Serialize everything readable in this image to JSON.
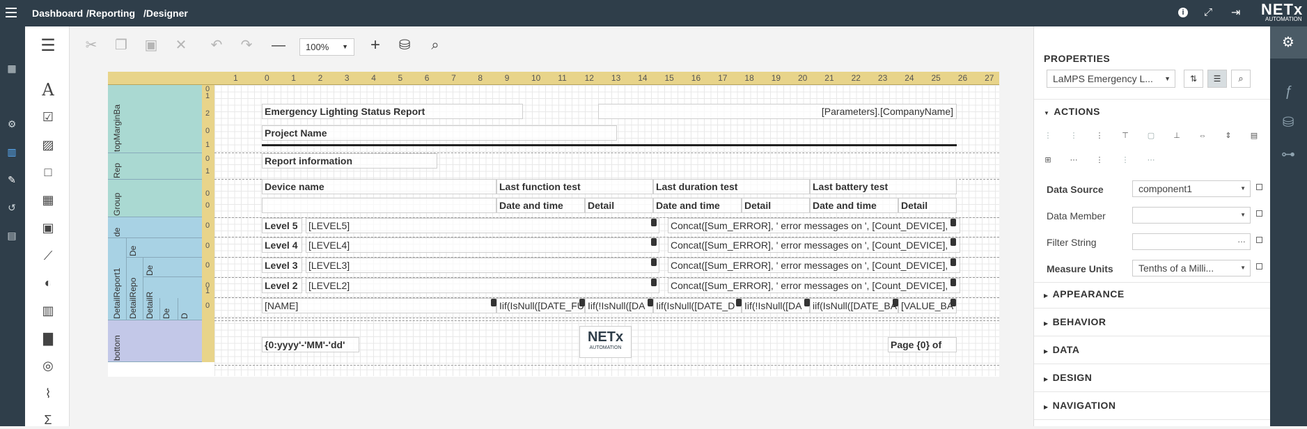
{
  "header": {
    "breadcrumb": [
      "Dashboard",
      "/Reporting",
      "/Designer"
    ],
    "brand": "NETx",
    "brand_sub": "AUTOMATION"
  },
  "toolbar": {
    "zoom": "100%"
  },
  "ruler": {
    "h_ticks": [
      "1",
      "0",
      "1",
      "2",
      "3",
      "4",
      "5",
      "6",
      "7",
      "8",
      "9",
      "10",
      "11",
      "12",
      "13",
      "14",
      "15",
      "16",
      "17",
      "18",
      "19",
      "20",
      "21",
      "22",
      "23",
      "24",
      "25",
      "26",
      "27"
    ],
    "v_ticks": [
      "0",
      "1",
      "2",
      "0",
      "1",
      "0",
      "1",
      "0",
      "0",
      "0",
      "0",
      "0",
      "0",
      "0",
      "1"
    ]
  },
  "bands": [
    "topMarginBa",
    "Rep",
    "Group",
    "de",
    "DetailReport1",
    "DetailRepo",
    "DetailR",
    "De",
    "De",
    "De",
    "D",
    "bottom"
  ],
  "report": {
    "title": "Emergency Lighting Status Report",
    "company": "[Parameters].[CompanyName]",
    "project": "Project Name",
    "report_info": "Report information",
    "col_device": "Device name",
    "col_last_function": "Last function test",
    "col_last_duration": "Last duration test",
    "col_last_battery": "Last battery test",
    "sub_date1": "Date and time",
    "sub_detail1": "Detail",
    "sub_date2": "Date and time",
    "sub_detail2": "Detail",
    "sub_date3": "Date and time",
    "sub_detail3": "Detail",
    "levels": [
      {
        "label": "Level 5",
        "field": "[LEVEL5]",
        "expr": "Concat([Sum_ERROR], ' error messages on ', [Count_DEVICE],"
      },
      {
        "label": "Level 4",
        "field": "[LEVEL4]",
        "expr": "Concat([Sum_ERROR], ' error messages on ', [Count_DEVICE],"
      },
      {
        "label": "Level 3",
        "field": "[LEVEL3]",
        "expr": "Concat([Sum_ERROR], ' error messages on ', [Count_DEVICE],"
      },
      {
        "label": "Level 2",
        "field": "[LEVEL2]",
        "expr": "Concat([Sum_ERROR], ' error messages on ', [Count_DEVICE],"
      }
    ],
    "detail_row": [
      "[NAME]",
      "Iif(IsNull([DATE_FU",
      "Iif(!IsNull([DA",
      "Iif(IsNull([DATE_D",
      "Iif(!IsNull([DA",
      "iif(IsNull([DATE_BA",
      "[VALUE_BA"
    ],
    "date_format": "{0:yyyy'-'MM'-'dd'",
    "page_text": "Page {0} of",
    "logo_text": "NETx",
    "logo_sub": "AUTOMATION"
  },
  "properties": {
    "title": "PROPERTIES",
    "selected_component": "LaMPS Emergency L...",
    "actions_label": "ACTIONS",
    "fields": [
      {
        "label": "Data Source",
        "value": "component1",
        "bold": true
      },
      {
        "label": "Data Member",
        "value": "",
        "bold": false
      },
      {
        "label": "Filter String",
        "value": "",
        "bold": false
      },
      {
        "label": "Measure Units",
        "value": "Tenths of a Milli...",
        "bold": true
      }
    ],
    "sections": [
      "APPEARANCE",
      "BEHAVIOR",
      "DATA",
      "DESIGN",
      "NAVIGATION"
    ]
  }
}
